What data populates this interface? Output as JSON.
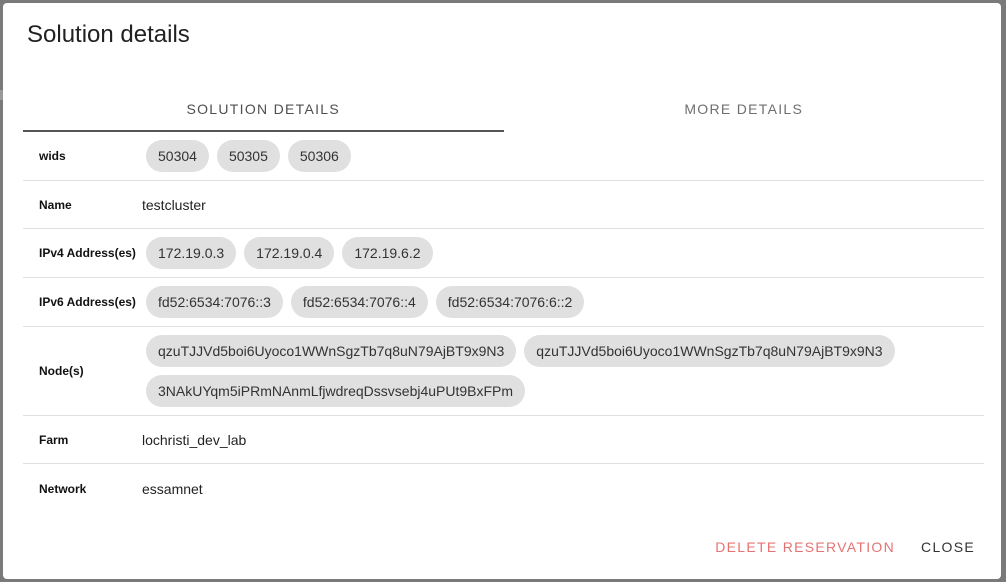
{
  "dialog": {
    "title": "Solution details",
    "tabs": [
      {
        "label": "Solution details"
      },
      {
        "label": "More details"
      }
    ],
    "rows": {
      "wids": {
        "label": "wids",
        "chips": [
          "50304",
          "50305",
          "50306"
        ]
      },
      "name": {
        "label": "Name",
        "value": "testcluster"
      },
      "ipv4": {
        "label": "IPv4 Address(es)",
        "chips": [
          "172.19.0.3",
          "172.19.0.4",
          "172.19.6.2"
        ]
      },
      "ipv6": {
        "label": "IPv6 Address(es)",
        "chips": [
          "fd52:6534:7076::3",
          "fd52:6534:7076::4",
          "fd52:6534:7076:6::2"
        ]
      },
      "nodes": {
        "label": "Node(s)",
        "chips": [
          "qzuTJJVd5boi6Uyoco1WWnSgzTb7q8uN79AjBT9x9N3",
          "qzuTJJVd5boi6Uyoco1WWnSgzTb7q8uN79AjBT9x9N3",
          "3NAkUYqm5iPRmNAnmLfjwdreqDssvsebj4uPUt9BxFPm"
        ]
      },
      "farm": {
        "label": "Farm",
        "value": "lochristi_dev_lab"
      },
      "network": {
        "label": "Network",
        "value": "essamnet"
      }
    },
    "actions": {
      "delete_label": "Delete reservation",
      "close_label": "Close"
    }
  }
}
